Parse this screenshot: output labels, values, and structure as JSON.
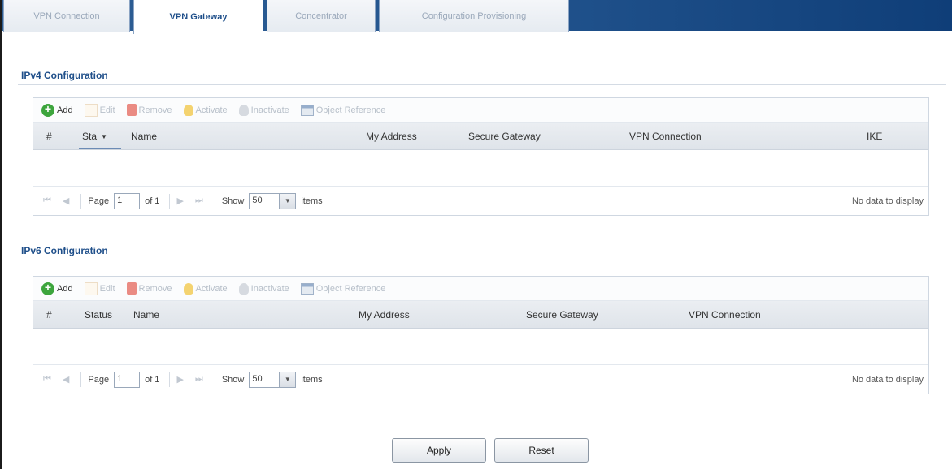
{
  "tabs": [
    {
      "label": "VPN Connection",
      "active": false
    },
    {
      "label": "VPN Gateway",
      "active": true
    },
    {
      "label": "Concentrator",
      "active": false
    },
    {
      "label": "Configuration Provisioning",
      "active": false
    }
  ],
  "toolbar": {
    "add": "Add",
    "edit": "Edit",
    "remove": "Remove",
    "activate": "Activate",
    "inactivate": "Inactivate",
    "object_reference": "Object Reference"
  },
  "ipv4": {
    "title": "IPv4 Configuration",
    "columns": {
      "num": "#",
      "status": "Sta",
      "name": "Name",
      "my_address": "My Address",
      "secure_gateway": "Secure Gateway",
      "vpn_connection": "VPN Connection",
      "ike": "IKE"
    },
    "pager": {
      "page_label": "Page",
      "page_value": "1",
      "of_label": "of 1",
      "show_label": "Show",
      "show_value": "50",
      "items_label": "items",
      "no_data": "No data to display"
    }
  },
  "ipv6": {
    "title": "IPv6 Configuration",
    "columns": {
      "num": "#",
      "status": "Status",
      "name": "Name",
      "my_address": "My Address",
      "secure_gateway": "Secure Gateway",
      "vpn_connection": "VPN Connection"
    },
    "pager": {
      "page_label": "Page",
      "page_value": "1",
      "of_label": "of 1",
      "show_label": "Show",
      "show_value": "50",
      "items_label": "items",
      "no_data": "No data to display"
    }
  },
  "buttons": {
    "apply": "Apply",
    "reset": "Reset"
  },
  "icons": {
    "first": "⏮",
    "prev": "◀",
    "next": "▶",
    "last": "⏭",
    "sort": "▼",
    "dropdown": "▼"
  }
}
